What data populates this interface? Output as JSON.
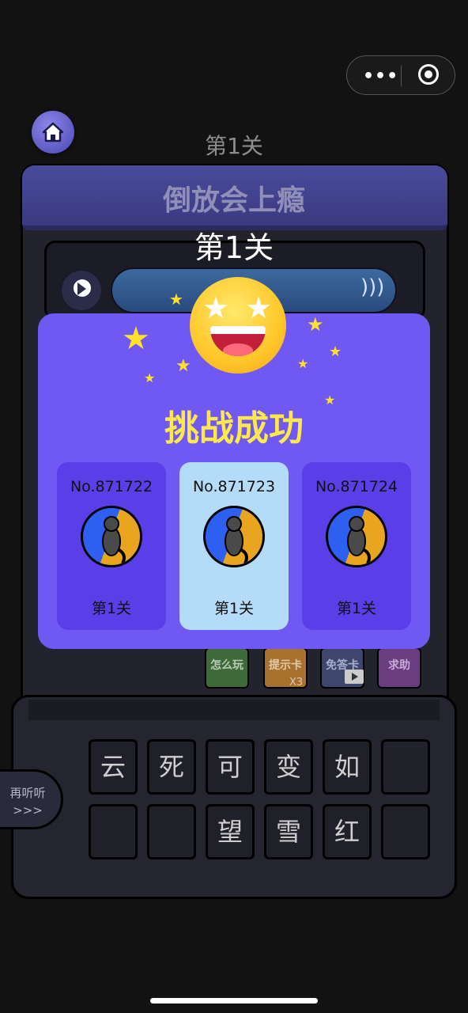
{
  "top_level_label": "第1关",
  "game_title": "倒放会上瘾",
  "overlay_level": "第1关",
  "success": {
    "title": "挑战成功",
    "cards": [
      {
        "number": "No.871722",
        "level": "第1关",
        "selected": false
      },
      {
        "number": "No.871723",
        "level": "第1关",
        "selected": true
      },
      {
        "number": "No.871724",
        "level": "第1关",
        "selected": false
      }
    ]
  },
  "tools": {
    "how_to_play": "怎么玩",
    "hint_card": "提示卡",
    "hint_count": "X3",
    "free_answer": "免答卡",
    "help": "求助"
  },
  "relisten": {
    "label": "再听听",
    "arrows": ">>>"
  },
  "keys": [
    "云",
    "死",
    "可",
    "变",
    "如",
    "",
    "",
    "",
    "望",
    "雪",
    "红",
    ""
  ],
  "icons": {
    "home": "home-icon",
    "play": "play-icon",
    "sound": "sound-wave-icon",
    "menu": "more-dots-icon",
    "close": "target-icon",
    "emoji": "star-eyes-emoji-icon"
  },
  "colors": {
    "modal_bg": "#7058f2",
    "success_text": "#ffe94a",
    "selected_card": "#b4dcf8"
  }
}
